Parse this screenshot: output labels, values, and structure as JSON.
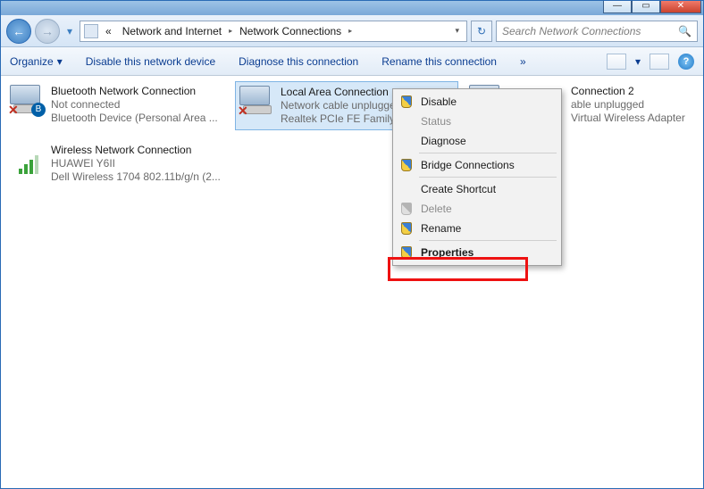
{
  "titlebar": {
    "minimize": "—",
    "maximize": "▭",
    "close": "✕"
  },
  "nav": {
    "back_glyph": "←",
    "fwd_glyph": "→",
    "hist_glyph": "▾",
    "root_glyph": "«",
    "crumb1": "Network and Internet",
    "crumb2": "Network Connections",
    "sep": "▸",
    "dropdown_glyph": "▾",
    "refresh_glyph": "↻"
  },
  "search": {
    "placeholder": "Search Network Connections",
    "mag_glyph": "🔍"
  },
  "toolbar": {
    "organize": "Organize",
    "organize_dd": "▾",
    "disable": "Disable this network device",
    "diagnose": "Diagnose this connection",
    "rename": "Rename this connection",
    "overflow": "»",
    "view_dd": "▾"
  },
  "connections": {
    "bt": {
      "title": "Bluetooth Network Connection",
      "status": "Not connected",
      "device": "Bluetooth Device (Personal Area ..."
    },
    "lan": {
      "title": "Local Area Connection",
      "status": "Network cable unplugged",
      "device": "Realtek PCIe FE Family"
    },
    "lan2": {
      "title": "Connection 2",
      "status": "able unplugged",
      "device": "Virtual Wireless Adapter"
    },
    "wifi": {
      "title": "Wireless Network Connection",
      "status": "HUAWEI Y6II",
      "device": "Dell Wireless 1704 802.11b/g/n (2..."
    }
  },
  "ctx": {
    "disable": "Disable",
    "status": "Status",
    "diagnose": "Diagnose",
    "bridge": "Bridge Connections",
    "shortcut": "Create Shortcut",
    "delete": "Delete",
    "rename": "Rename",
    "properties": "Properties"
  }
}
